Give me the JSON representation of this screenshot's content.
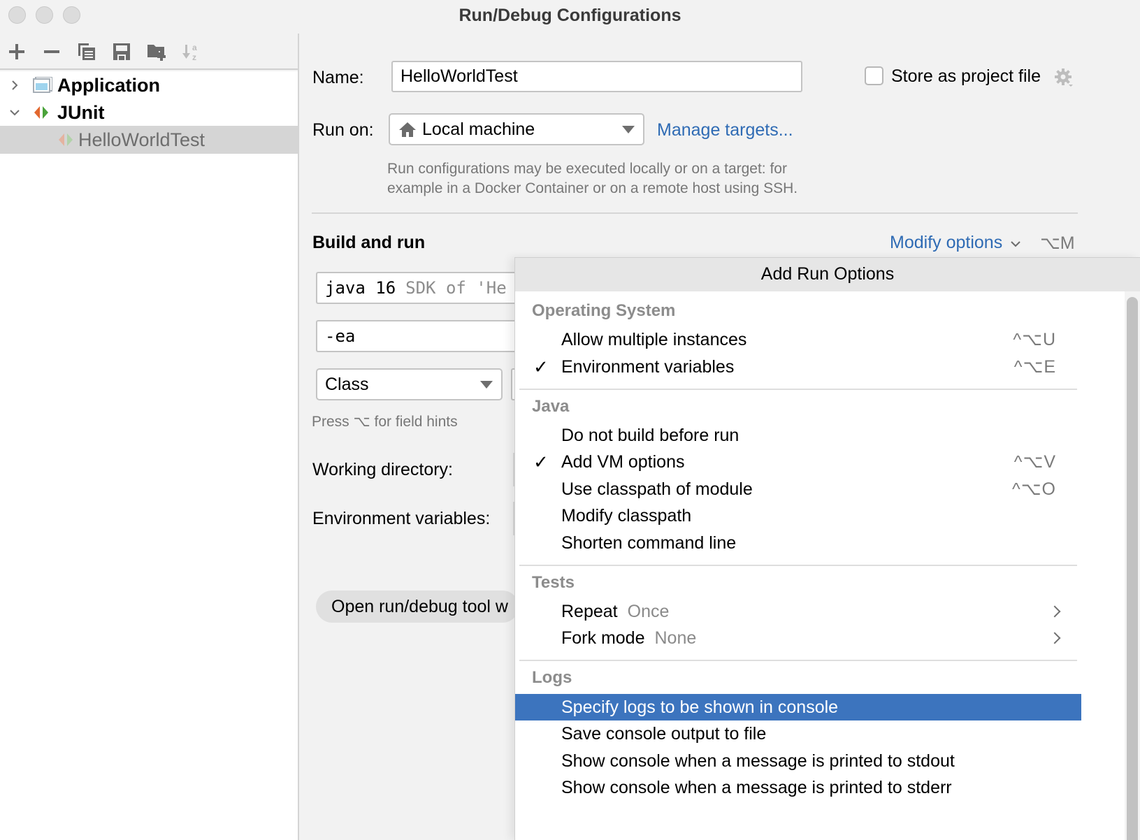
{
  "window": {
    "title": "Run/Debug Configurations"
  },
  "sidebar": {
    "toolbar": [
      {
        "icon": "add-icon",
        "tooltip": "Add"
      },
      {
        "icon": "remove-icon",
        "tooltip": "Remove"
      },
      {
        "icon": "copy-icon",
        "tooltip": "Copy"
      },
      {
        "icon": "save-icon",
        "tooltip": "Save"
      },
      {
        "icon": "new-folder-icon",
        "tooltip": "New folder"
      },
      {
        "icon": "sort-alpha-icon",
        "tooltip": "Sort"
      }
    ],
    "tree": [
      {
        "label": "Application",
        "expanded": false,
        "icon": "application-icon"
      },
      {
        "label": "JUnit",
        "expanded": true,
        "icon": "junit-icon"
      },
      {
        "label": "HelloWorldTest",
        "selected": true,
        "icon": "junit-test-icon"
      }
    ]
  },
  "form": {
    "name_label": "Name:",
    "name_value": "HelloWorldTest",
    "store_label": "Store as project file",
    "store_checked": false,
    "run_on_label": "Run on:",
    "run_on_value": "Local machine",
    "manage_targets": "Manage targets...",
    "run_on_hint_1": "Run configurations may be executed locally or on a target: for",
    "run_on_hint_2": "example in a Docker Container or on a remote host using SSH.",
    "section_title": "Build and run",
    "modify_options": "Modify options",
    "modify_shortcut": "⌥M",
    "jdk_value": "java 16",
    "jdk_hint": "SDK of 'He",
    "vm_options": "-ea",
    "test_kind": "Class",
    "field_hints": "Press ⌥ for field hints",
    "working_dir_label": "Working directory:",
    "env_vars_label": "Environment variables:",
    "open_tool_window": "Open run/debug tool w"
  },
  "popup": {
    "title": "Add Run Options",
    "groups": [
      {
        "title": "Operating System",
        "items": [
          {
            "label": "Allow multiple instances",
            "checked": false,
            "shortcut": "^⌥U"
          },
          {
            "label": "Environment variables",
            "checked": true,
            "shortcut": "^⌥E"
          }
        ]
      },
      {
        "title": "Java",
        "items": [
          {
            "label": "Do not build before run",
            "checked": false,
            "shortcut": ""
          },
          {
            "label": "Add VM options",
            "checked": true,
            "shortcut": "^⌥V"
          },
          {
            "label": "Use classpath of module",
            "checked": false,
            "shortcut": "^⌥O"
          },
          {
            "label": "Modify classpath",
            "checked": false,
            "shortcut": ""
          },
          {
            "label": "Shorten command line",
            "checked": false,
            "shortcut": ""
          }
        ]
      },
      {
        "title": "Tests",
        "items": [
          {
            "label": "Repeat",
            "value": "Once",
            "submenu": true
          },
          {
            "label": "Fork mode",
            "value": "None",
            "submenu": true
          }
        ]
      },
      {
        "title": "Logs",
        "items": [
          {
            "label": "Specify logs to be shown in console",
            "highlighted": true
          },
          {
            "label": "Save console output to file"
          },
          {
            "label": "Show console when a message is printed to stdout"
          },
          {
            "label": "Show console when a message is printed to stderr"
          }
        ]
      }
    ],
    "check_glyph": "✓"
  },
  "colors": {
    "accent": "#3c74be",
    "link": "#2f6bb4",
    "selection": "#d5d5d5"
  }
}
